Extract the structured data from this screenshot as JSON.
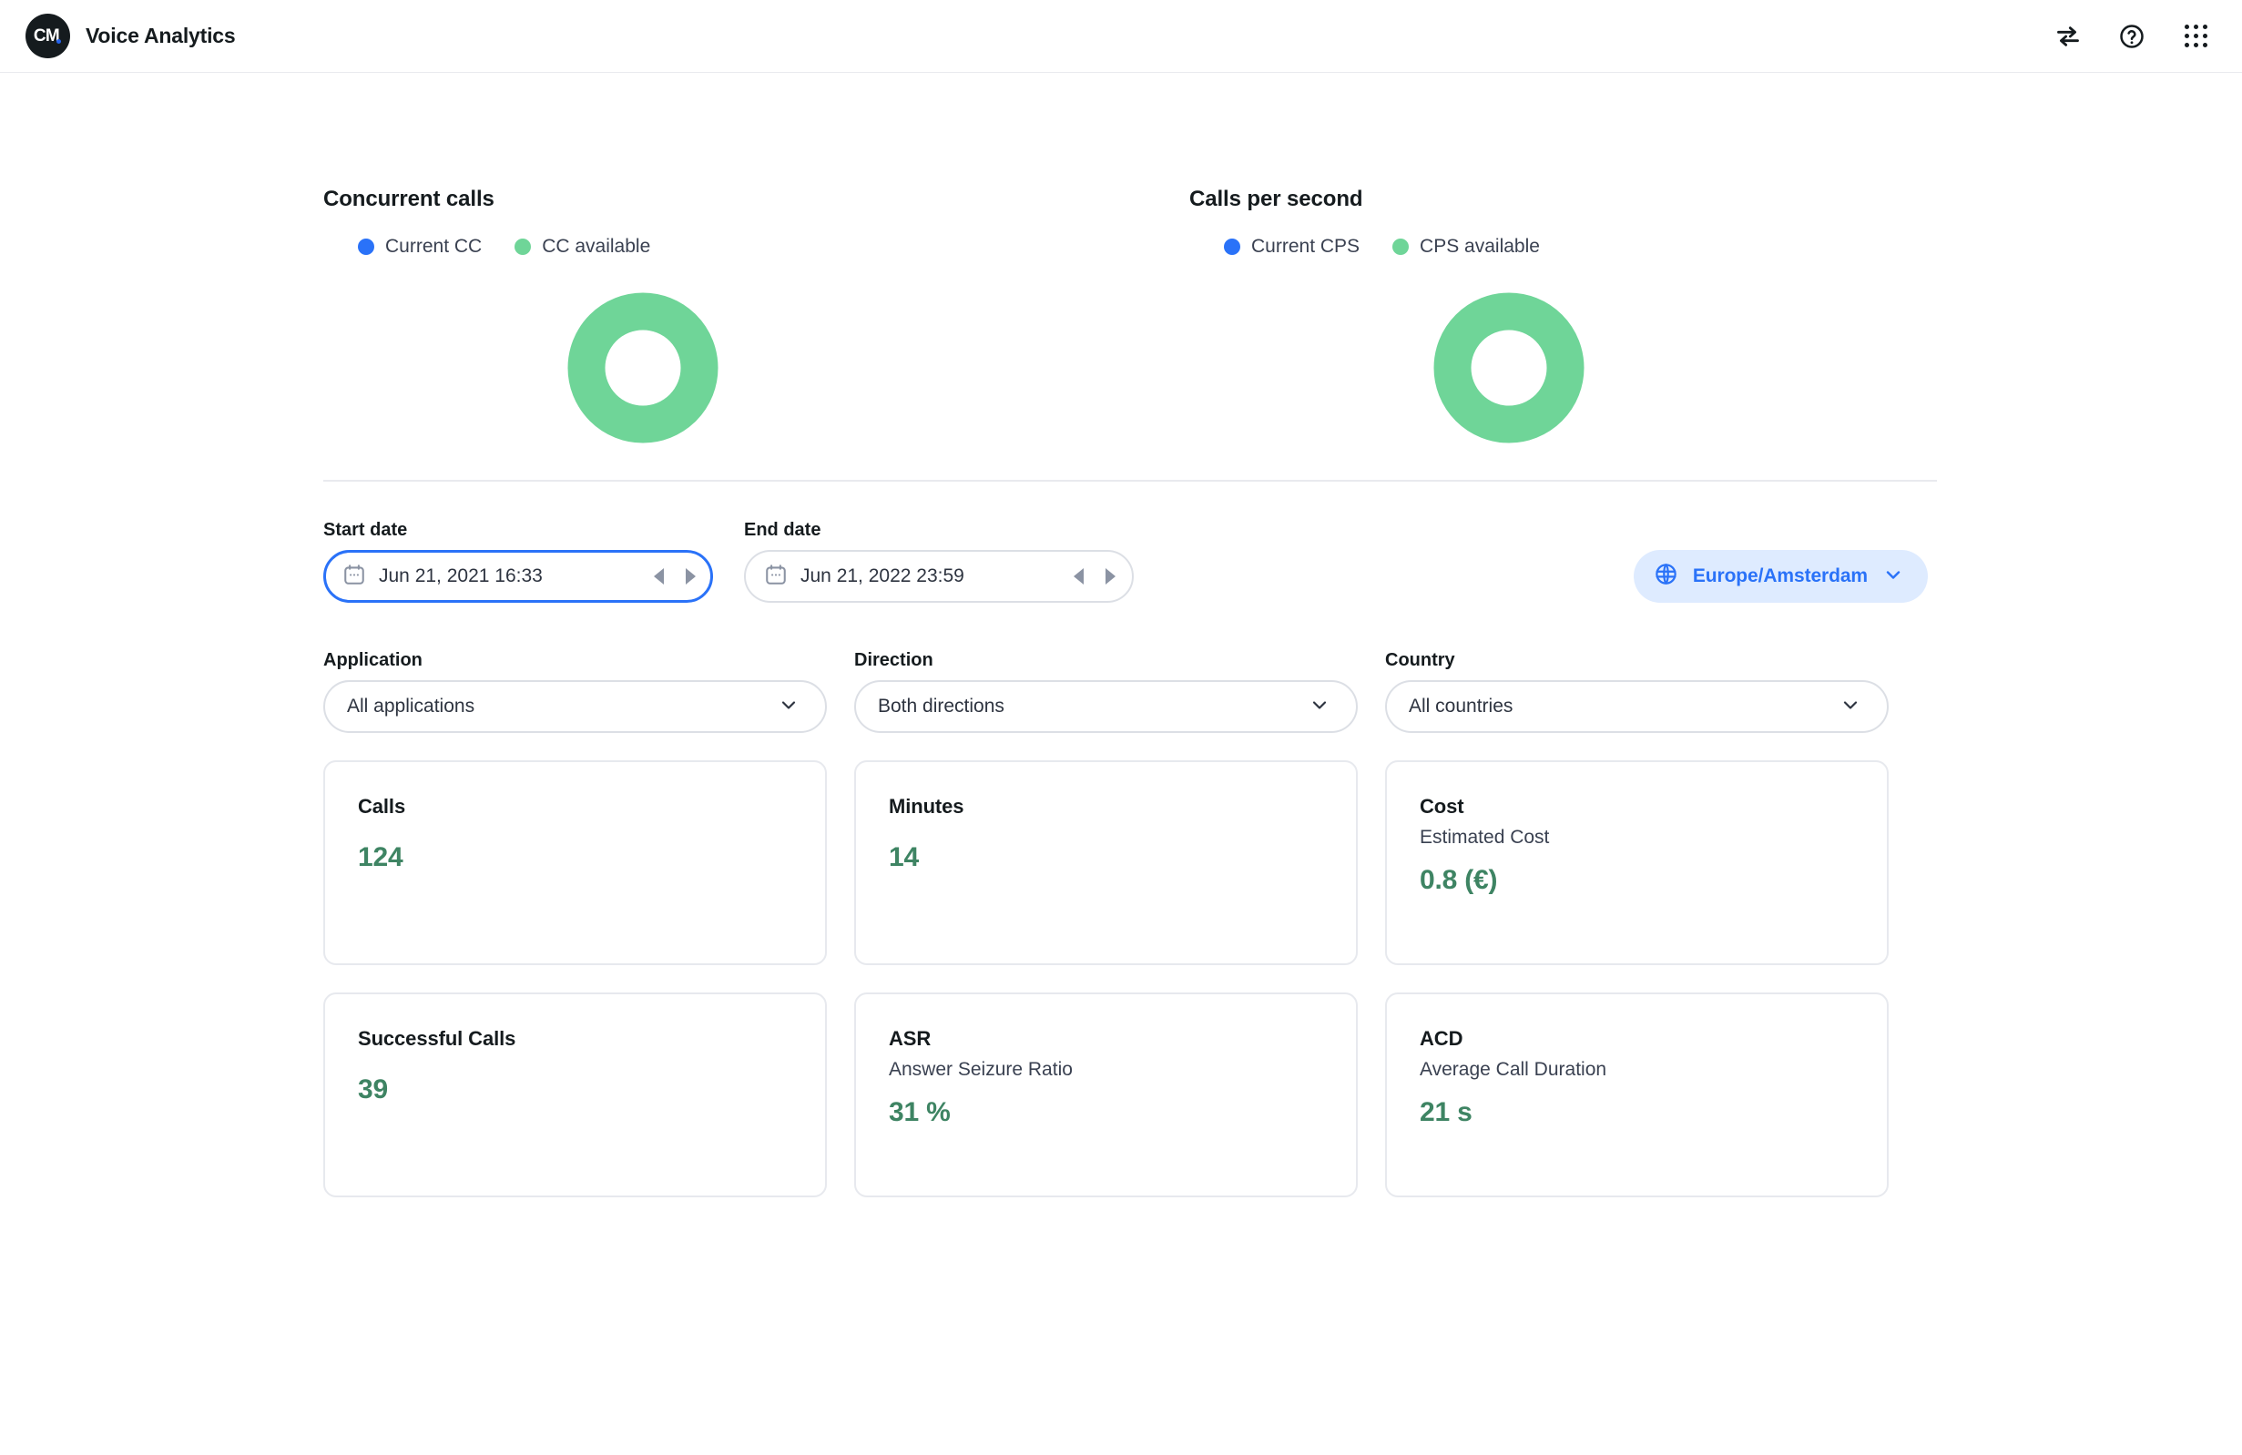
{
  "header": {
    "logo_text": "CM",
    "title": "Voice Analytics",
    "icons": [
      {
        "name": "transfer-arrows-icon",
        "label": "transfer"
      },
      {
        "name": "help-circle-icon",
        "label": "?"
      },
      {
        "name": "app-grid-icon",
        "label": "apps"
      }
    ]
  },
  "gauges": [
    {
      "title": "Concurrent calls",
      "legend": [
        {
          "label": "Current CC",
          "color": "#2a72f8"
        },
        {
          "label": "CC available",
          "color": "#6fd598"
        }
      ],
      "current_value": 0,
      "available_value": 100
    },
    {
      "title": "Calls per second",
      "legend": [
        {
          "label": "Current CPS",
          "color": "#2a72f8"
        },
        {
          "label": "CPS available",
          "color": "#6fd598"
        }
      ],
      "current_value": 0,
      "available_value": 100
    }
  ],
  "chart_data": [
    {
      "type": "pie",
      "title": "Concurrent calls",
      "labels": [
        "Current CC",
        "CC available"
      ],
      "values": [
        0,
        100
      ],
      "colors": [
        "#2a72f8",
        "#6fd598"
      ],
      "legend_position": "top",
      "donut": true
    },
    {
      "type": "pie",
      "title": "Calls per second",
      "labels": [
        "Current CPS",
        "CPS available"
      ],
      "values": [
        0,
        100
      ],
      "colors": [
        "#2a72f8",
        "#6fd598"
      ],
      "legend_position": "top",
      "donut": true
    }
  ],
  "date_range": {
    "start": {
      "label": "Start date",
      "value": "Jun 21, 2021 16:33"
    },
    "end": {
      "label": "End date",
      "value": "Jun 21, 2022 23:59"
    },
    "timezone": "Europe/Amsterdam"
  },
  "filters": [
    {
      "label": "Application",
      "value": "All applications"
    },
    {
      "label": "Direction",
      "value": "Both directions"
    },
    {
      "label": "Country",
      "value": "All countries"
    }
  ],
  "cards": [
    {
      "title": "Calls",
      "subtitle": "",
      "value": "124"
    },
    {
      "title": "Minutes",
      "subtitle": "",
      "value": "14"
    },
    {
      "title": "Cost",
      "subtitle": "Estimated Cost",
      "value": "0.8 (€)"
    },
    {
      "title": "Successful Calls",
      "subtitle": "",
      "value": "39"
    },
    {
      "title": "ASR",
      "subtitle": "Answer Seizure Ratio",
      "value": "31 %"
    },
    {
      "title": "ACD",
      "subtitle": "Average Call Duration",
      "value": "21 s"
    }
  ],
  "colors": {
    "accent_blue": "#2a72f8",
    "green_available": "#6fd598",
    "value_green": "#3e8463",
    "text_dark": "#151b1e"
  }
}
